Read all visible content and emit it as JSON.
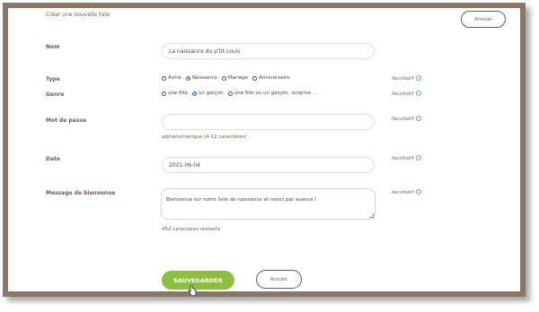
{
  "header": {
    "title": "Créer une nouvelle liste",
    "cancel_label": "Annuler"
  },
  "form": {
    "name": {
      "label": "Nom",
      "value": "La naissance du p'tit Louis"
    },
    "type": {
      "label": "Type",
      "options": [
        "Autre",
        "Naissance",
        "Mariage",
        "Anniversaire"
      ],
      "selected": "Naissance",
      "hint": "facultatif"
    },
    "gender": {
      "label": "Genre",
      "options": [
        "une fille",
        "un garçon",
        "une fille ou un garçon, surprise ..."
      ],
      "selected": "un garçon",
      "hint": "facultatif"
    },
    "password": {
      "label": "Mot de passe",
      "value": "",
      "help": "alphanumérique (4-12 caractères)",
      "hint": "facultatif"
    },
    "date": {
      "label": "Date",
      "value": "2021-06-04",
      "hint": "facultatif"
    },
    "message": {
      "label": "Message de bienvenue",
      "value": "Bienvenue sur notre liste de naissance et merci par avance !",
      "remaining": "452 caracteres restants",
      "hint": "facultatif"
    }
  },
  "footer": {
    "save_label": "SAUVEGARDER",
    "cancel_label": "Annuler"
  },
  "icons": {
    "info": "info-icon",
    "cursor": "hand-pointer-icon"
  },
  "colors": {
    "accent": "#8cbf3f",
    "radio": "#2c62c9",
    "info": "#6aa0dc",
    "frame": "#8a7668"
  }
}
